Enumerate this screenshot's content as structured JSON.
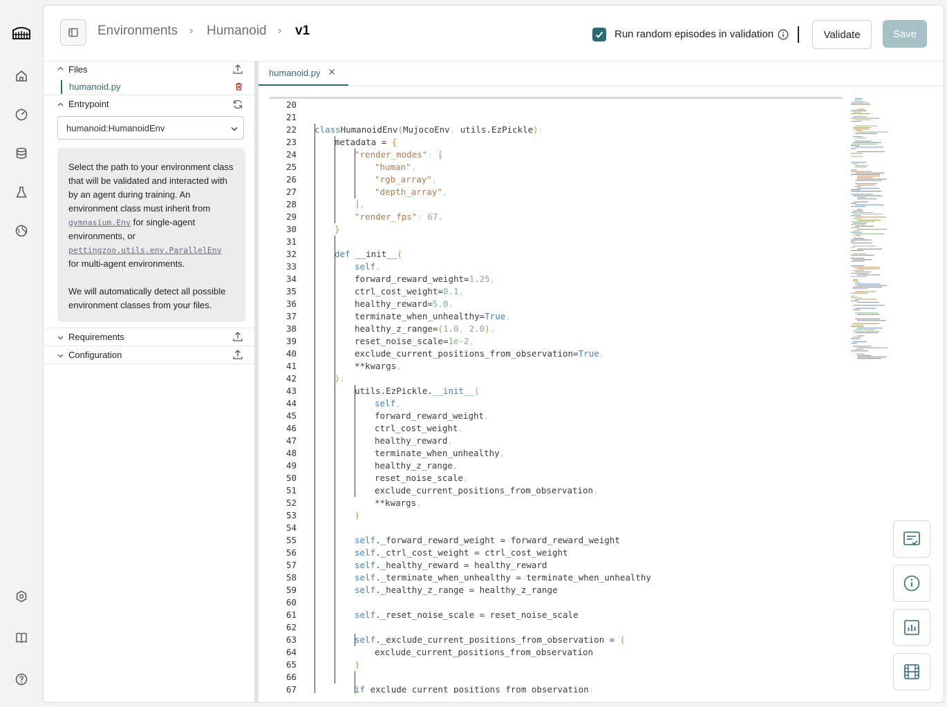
{
  "rail": {
    "icons": [
      "colosseum-logo-icon",
      "home-icon",
      "gauge-icon",
      "database-icon",
      "flask-icon",
      "globe-icon",
      "settings-hex-icon",
      "book-icon",
      "help-icon"
    ]
  },
  "header": {
    "breadcrumbs": [
      "Environments",
      "Humanoid",
      "v1"
    ],
    "random_episodes_label": "Run random episodes in validation",
    "random_episodes_checked": true,
    "validate_label": "Validate",
    "save_label": "Save"
  },
  "sidebar": {
    "files_title": "Files",
    "file_name": "humanoid.py",
    "entrypoint_title": "Entrypoint",
    "entrypoint_value": "humanoid:HumanoidEnv",
    "help_p1_a": "Select the path to your environment class that will be validated and interacted with by an agent during training. An environment class must inherit from ",
    "help_p1_code1": "gymnasium.Env",
    "help_p1_b": " for single-agent environments, or ",
    "help_p1_code2": "pettingzoo.utils.env.ParallelEnv",
    "help_p1_c": " for multi-agent environments.",
    "help_p2": "We will automatically detect all possible environment classes from your files.",
    "requirements_title": "Requirements",
    "configuration_title": "Configuration"
  },
  "editor": {
    "tab_label": "humanoid.py",
    "lines": [
      {
        "n": "21",
        "indent": 0,
        "tokens": []
      },
      {
        "n": "22",
        "indent": 0,
        "tokens": [
          [
            "kw",
            "class"
          ],
          [
            "",
            "HumanoidEnv"
          ],
          [
            "par",
            "("
          ],
          [
            "",
            "MujocoEnv"
          ],
          [
            "pun",
            ", "
          ],
          [
            "",
            "utils.EzPickle"
          ],
          [
            "par",
            ")"
          ],
          [
            "pun",
            ":"
          ]
        ]
      },
      {
        "n": "23",
        "indent": 1,
        "tokens": [
          [
            "",
            "metadata = "
          ],
          [
            "par",
            "{"
          ]
        ]
      },
      {
        "n": "24",
        "indent": 2,
        "tokens": [
          [
            "str",
            "\"render_modes\""
          ],
          [
            "pun",
            ": "
          ],
          [
            "br2",
            "["
          ]
        ]
      },
      {
        "n": "25",
        "indent": 3,
        "tokens": [
          [
            "str",
            "\"human\""
          ],
          [
            "pun",
            ","
          ]
        ]
      },
      {
        "n": "26",
        "indent": 3,
        "tokens": [
          [
            "str",
            "\"rgb_array\""
          ],
          [
            "pun",
            ","
          ]
        ]
      },
      {
        "n": "27",
        "indent": 3,
        "tokens": [
          [
            "str",
            "\"depth_array\""
          ],
          [
            "pun",
            ","
          ]
        ]
      },
      {
        "n": "28",
        "indent": 2,
        "tokens": [
          [
            "br2",
            "]"
          ],
          [
            "pun",
            ","
          ]
        ]
      },
      {
        "n": "29",
        "indent": 2,
        "tokens": [
          [
            "str",
            "\"render_fps\""
          ],
          [
            "pun",
            ": "
          ],
          [
            "num",
            "67"
          ],
          [
            "pun",
            ","
          ]
        ]
      },
      {
        "n": "30",
        "indent": 1,
        "tokens": [
          [
            "par",
            "}"
          ]
        ]
      },
      {
        "n": "31",
        "indent": 0,
        "tokens": []
      },
      {
        "n": "32",
        "indent": 1,
        "tokens": [
          [
            "kw",
            "def"
          ],
          [
            "",
            " __init__"
          ],
          [
            "par",
            "("
          ]
        ]
      },
      {
        "n": "33",
        "indent": 2,
        "tokens": [
          [
            "kw",
            "self"
          ],
          [
            "pun",
            ","
          ]
        ]
      },
      {
        "n": "34",
        "indent": 2,
        "tokens": [
          [
            "",
            "forward_reward_weight="
          ],
          [
            "num",
            "1.25"
          ],
          [
            "pun",
            ","
          ]
        ]
      },
      {
        "n": "35",
        "indent": 2,
        "tokens": [
          [
            "",
            "ctrl_cost_weight="
          ],
          [
            "num",
            "0.1"
          ],
          [
            "pun",
            ","
          ]
        ]
      },
      {
        "n": "36",
        "indent": 2,
        "tokens": [
          [
            "",
            "healthy_reward="
          ],
          [
            "num",
            "5.0"
          ],
          [
            "pun",
            ","
          ]
        ]
      },
      {
        "n": "37",
        "indent": 2,
        "tokens": [
          [
            "",
            "terminate_when_unhealthy="
          ],
          [
            "kw",
            "True"
          ],
          [
            "pun",
            ","
          ]
        ]
      },
      {
        "n": "38",
        "indent": 2,
        "tokens": [
          [
            "",
            "healthy_z_range="
          ],
          [
            "par",
            "("
          ],
          [
            "num",
            "1.0"
          ],
          [
            "pun",
            ", "
          ],
          [
            "num",
            "2.0"
          ],
          [
            "par",
            ")"
          ],
          [
            "pun",
            ","
          ]
        ]
      },
      {
        "n": "39",
        "indent": 2,
        "tokens": [
          [
            "",
            "reset_noise_scale="
          ],
          [
            "num",
            "1e-2"
          ],
          [
            "pun",
            ","
          ]
        ]
      },
      {
        "n": "40",
        "indent": 2,
        "tokens": [
          [
            "",
            "exclude_current_positions_from_observation="
          ],
          [
            "kw",
            "True"
          ],
          [
            "pun",
            ","
          ]
        ]
      },
      {
        "n": "41",
        "indent": 2,
        "tokens": [
          [
            "",
            "**kwargs"
          ],
          [
            "pun",
            ","
          ]
        ]
      },
      {
        "n": "42",
        "indent": 1,
        "tokens": [
          [
            "par",
            ")"
          ],
          [
            "pun",
            ":"
          ]
        ]
      },
      {
        "n": "43",
        "indent": 2,
        "tokens": [
          [
            "",
            "utils.EzPickle."
          ],
          [
            "kw",
            "__init__"
          ],
          [
            "par",
            "("
          ]
        ]
      },
      {
        "n": "44",
        "indent": 3,
        "tokens": [
          [
            "kw",
            "self"
          ],
          [
            "pun",
            ","
          ]
        ]
      },
      {
        "n": "45",
        "indent": 3,
        "tokens": [
          [
            "",
            "forward_reward_weight"
          ],
          [
            "pun",
            ","
          ]
        ]
      },
      {
        "n": "46",
        "indent": 3,
        "tokens": [
          [
            "",
            "ctrl_cost_weight"
          ],
          [
            "pun",
            ","
          ]
        ]
      },
      {
        "n": "47",
        "indent": 3,
        "tokens": [
          [
            "",
            "healthy_reward"
          ],
          [
            "pun",
            ","
          ]
        ]
      },
      {
        "n": "48",
        "indent": 3,
        "tokens": [
          [
            "",
            "terminate_when_unhealthy"
          ],
          [
            "pun",
            ","
          ]
        ]
      },
      {
        "n": "49",
        "indent": 3,
        "tokens": [
          [
            "",
            "healthy_z_range"
          ],
          [
            "pun",
            ","
          ]
        ]
      },
      {
        "n": "50",
        "indent": 3,
        "tokens": [
          [
            "",
            "reset_noise_scale"
          ],
          [
            "pun",
            ","
          ]
        ]
      },
      {
        "n": "51",
        "indent": 3,
        "tokens": [
          [
            "",
            "exclude_current_positions_from_observation"
          ],
          [
            "pun",
            ","
          ]
        ]
      },
      {
        "n": "52",
        "indent": 3,
        "tokens": [
          [
            "",
            "**kwargs"
          ],
          [
            "pun",
            ","
          ]
        ]
      },
      {
        "n": "53",
        "indent": 2,
        "tokens": [
          [
            "par",
            ")"
          ]
        ]
      },
      {
        "n": "54",
        "indent": 0,
        "tokens": []
      },
      {
        "n": "55",
        "indent": 2,
        "tokens": [
          [
            "kw",
            "self"
          ],
          [
            "",
            "._forward_reward_weight = forward_reward_weight"
          ]
        ]
      },
      {
        "n": "56",
        "indent": 2,
        "tokens": [
          [
            "kw",
            "self"
          ],
          [
            "",
            "._ctrl_cost_weight = ctrl_cost_weight"
          ]
        ]
      },
      {
        "n": "57",
        "indent": 2,
        "tokens": [
          [
            "kw",
            "self"
          ],
          [
            "",
            "._healthy_reward = healthy_reward"
          ]
        ]
      },
      {
        "n": "58",
        "indent": 2,
        "tokens": [
          [
            "kw",
            "self"
          ],
          [
            "",
            "._terminate_when_unhealthy = terminate_when_unhealthy"
          ]
        ]
      },
      {
        "n": "59",
        "indent": 2,
        "tokens": [
          [
            "kw",
            "self"
          ],
          [
            "",
            "._healthy_z_range = healthy_z_range"
          ]
        ]
      },
      {
        "n": "60",
        "indent": 0,
        "tokens": []
      },
      {
        "n": "61",
        "indent": 2,
        "tokens": [
          [
            "kw",
            "self"
          ],
          [
            "",
            "._reset_noise_scale = reset_noise_scale"
          ]
        ]
      },
      {
        "n": "62",
        "indent": 0,
        "tokens": []
      },
      {
        "n": "63",
        "indent": 2,
        "tokens": [
          [
            "kw",
            "self"
          ],
          [
            "",
            "._exclude_current_positions_from_observation = "
          ],
          [
            "par",
            "("
          ]
        ]
      },
      {
        "n": "64",
        "indent": 3,
        "tokens": [
          [
            "",
            "exclude_current_positions_from_observation"
          ]
        ]
      },
      {
        "n": "65",
        "indent": 2,
        "tokens": [
          [
            "par",
            ")"
          ]
        ]
      },
      {
        "n": "66",
        "indent": 0,
        "tokens": []
      },
      {
        "n": "67",
        "indent": 2,
        "tokens": [
          [
            "kw",
            "if"
          ],
          [
            "",
            " exclude_current_positions_from_observation"
          ],
          [
            "pun",
            ":"
          ]
        ]
      }
    ]
  },
  "fabs": [
    "checklist-icon",
    "info-icon",
    "bar-chart-icon",
    "film-icon"
  ],
  "colors": {
    "accent": "#2d6b74",
    "save_disabled": "#a7c0c6"
  }
}
